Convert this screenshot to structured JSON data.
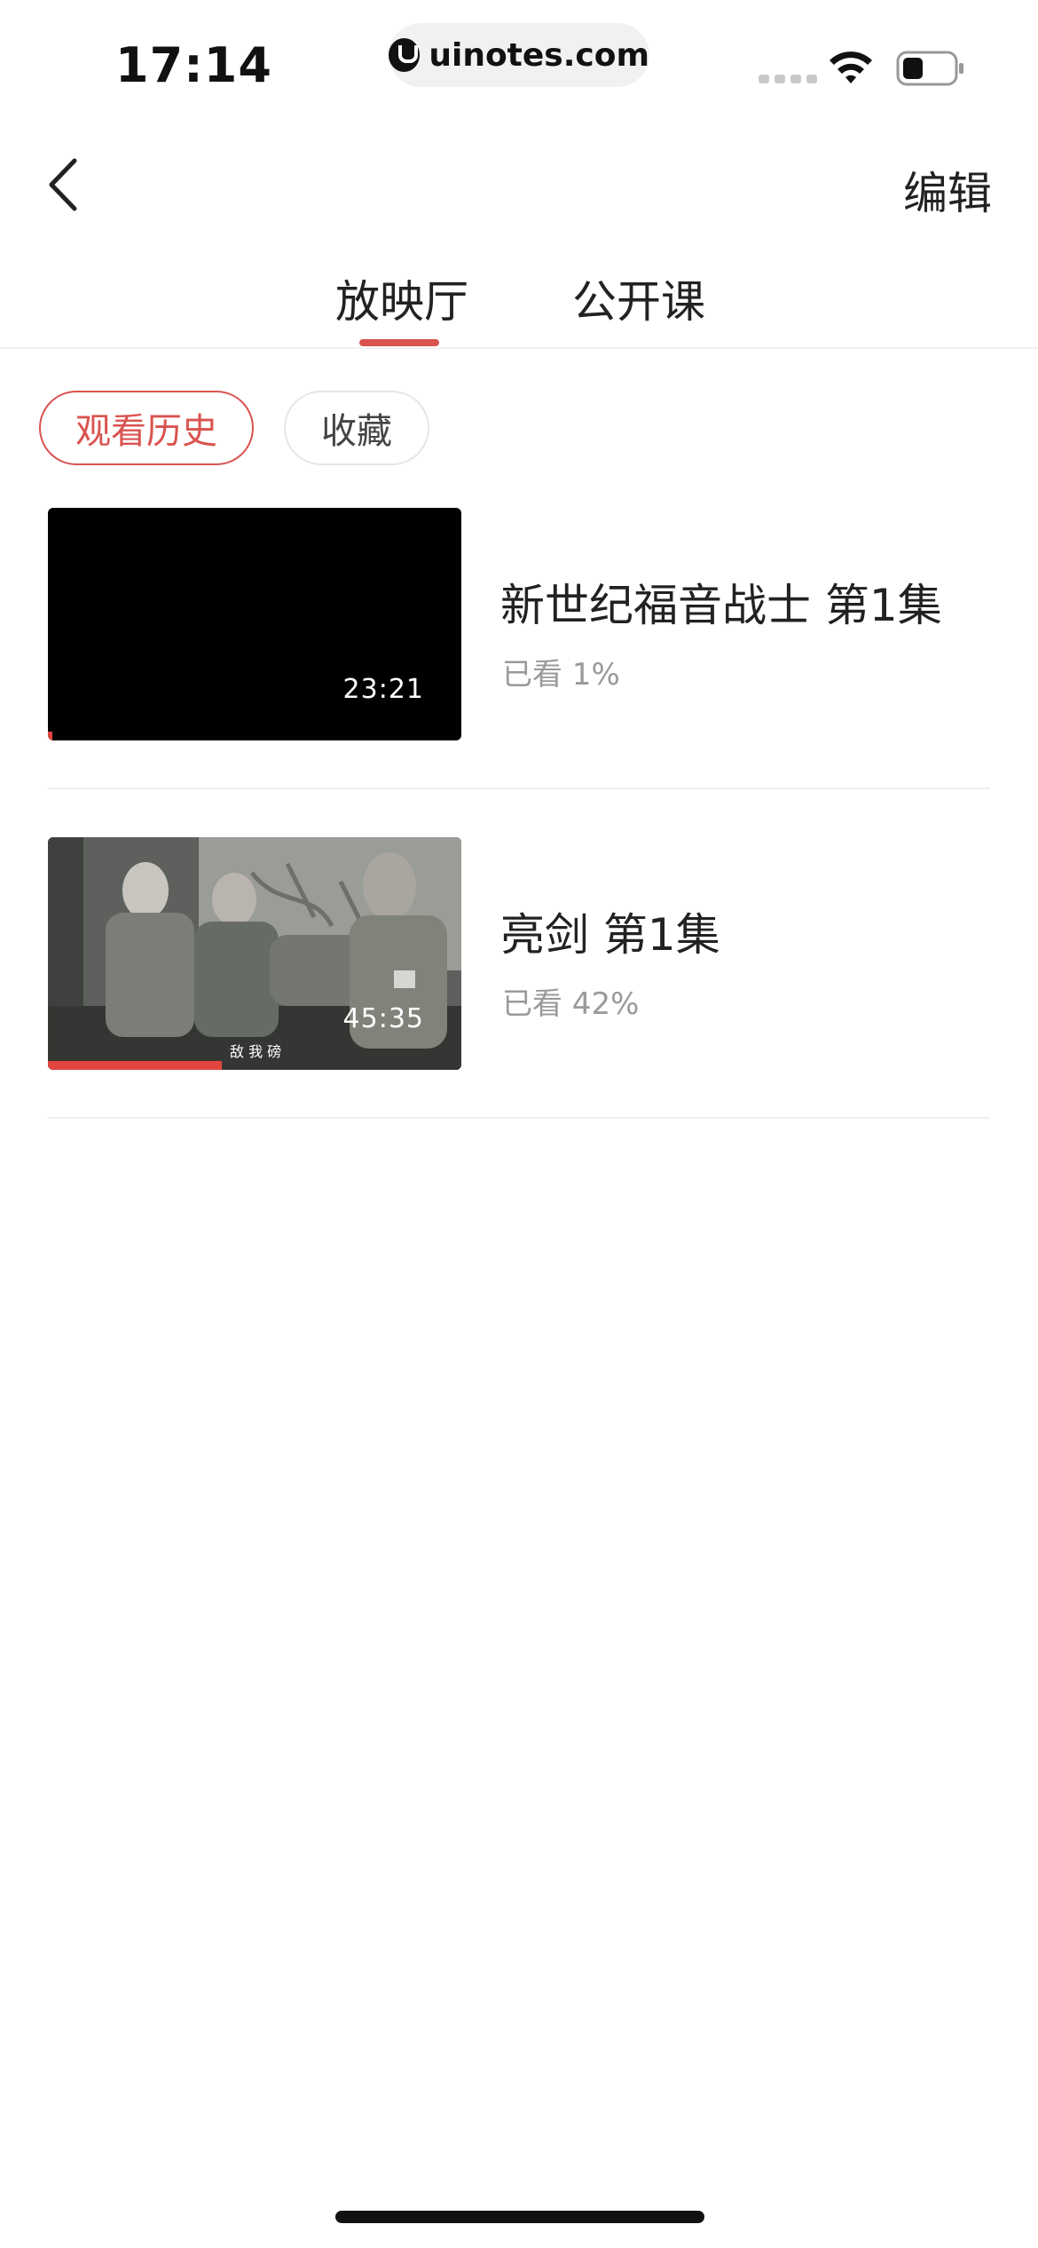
{
  "status_bar": {
    "time": "17:14",
    "url": "uinotes.com",
    "icons": [
      "signal-icon",
      "wifi-icon",
      "battery-icon"
    ]
  },
  "nav": {
    "back_icon": "chevron-left-icon",
    "edit_label": "编辑"
  },
  "tabs": [
    {
      "label": "放映厅",
      "active": true
    },
    {
      "label": "公开课",
      "active": false
    }
  ],
  "filters": [
    {
      "label": "观看历史",
      "active": true
    },
    {
      "label": "收藏",
      "active": false
    }
  ],
  "history": [
    {
      "title": "新世纪福音战士 第1集",
      "progress_text": "已看 1%",
      "progress": 0.01,
      "duration": "23:21",
      "subtitle": ""
    },
    {
      "title": "亮剑 第1集",
      "progress_text": "已看 42%",
      "progress": 0.42,
      "duration": "45:35",
      "subtitle": "敌 我 磅"
    }
  ],
  "colors": {
    "accent": "#d9534f",
    "progress": "#e0463e",
    "muted_text": "#9a9a9a"
  }
}
